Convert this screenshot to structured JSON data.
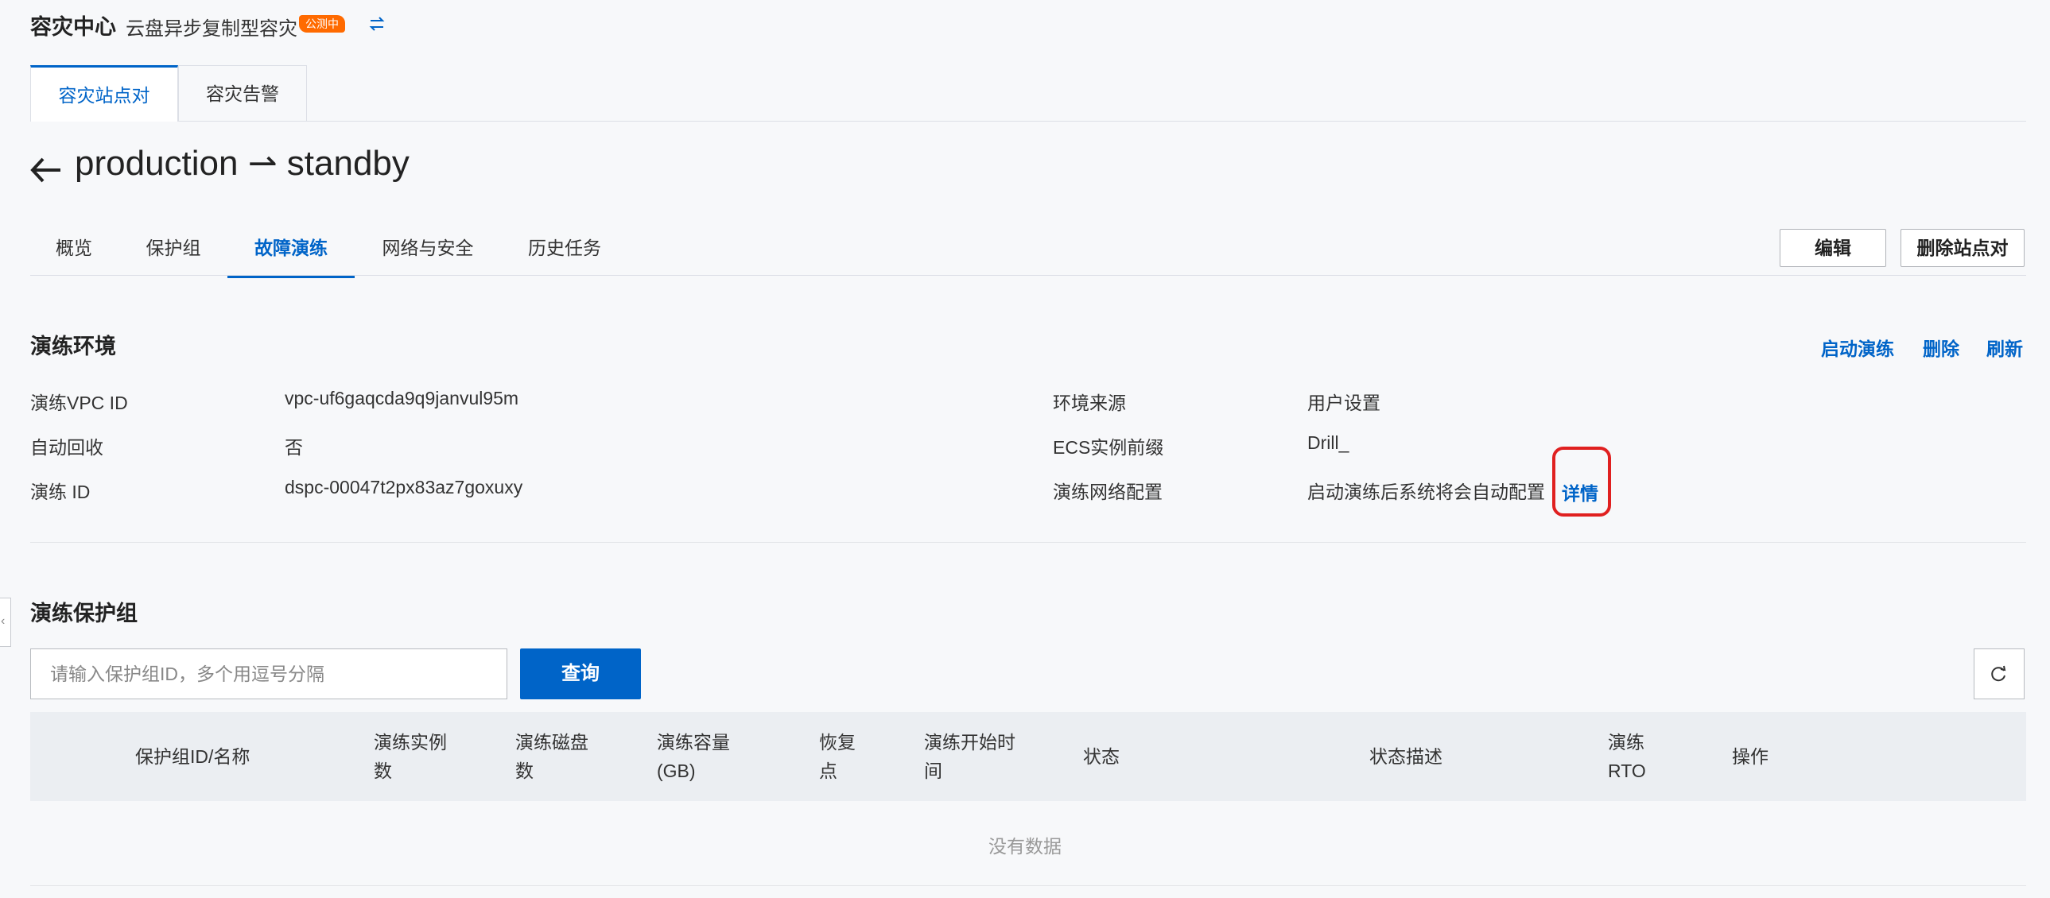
{
  "header": {
    "title": "容灾中心",
    "subtitle": "云盘异步复制型容灾",
    "badge": "公测中"
  },
  "top_tabs": [
    "容灾站点对",
    "容灾告警"
  ],
  "page_title": "production ⇀ standby",
  "sub_tabs": [
    "概览",
    "保护组",
    "故障演练",
    "网络与安全",
    "历史任务"
  ],
  "actions": {
    "edit": "编辑",
    "delete_pair": "删除站点对"
  },
  "drill_env": {
    "title": "演练环境",
    "links": {
      "start": "启动演练",
      "delete": "删除",
      "refresh": "刷新"
    },
    "fields_left": [
      {
        "label": "演练VPC ID",
        "value": "vpc-uf6gaqcda9q9janvul95m"
      },
      {
        "label": "自动回收",
        "value": "否"
      },
      {
        "label": "演练 ID",
        "value": "dspc-00047t2px83az7goxuxy"
      }
    ],
    "fields_right": [
      {
        "label": "环境来源",
        "value": "用户设置"
      },
      {
        "label": "ECS实例前缀",
        "value": "Drill_"
      },
      {
        "label": "演练网络配置",
        "value": "启动演练后系统将会自动配置"
      }
    ],
    "detail_link": "详情"
  },
  "protect_group": {
    "title": "演练保护组",
    "search_placeholder": "请输入保护组ID，多个用逗号分隔",
    "query_button": "查询",
    "columns": [
      "保护组ID/名称",
      "演练实例\n数",
      "演练磁盘\n数",
      "演练容量\n(GB)",
      "恢复\n点",
      "演练开始时\n间",
      "状态",
      "状态描述",
      "演练\nRTO",
      "操作"
    ],
    "empty_text": "没有数据"
  },
  "colors": {
    "accent": "#0064c8",
    "badge": "#ff6a00",
    "highlight": "#e02020"
  }
}
